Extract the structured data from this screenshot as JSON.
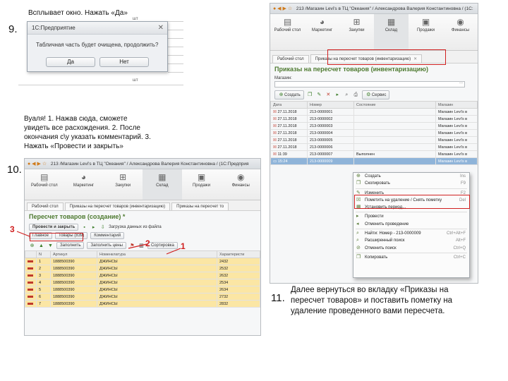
{
  "step9": {
    "number": "9.",
    "caption": "Всплывает окно. Нажать «Да»",
    "dialog": {
      "title": "1С:Предприятие",
      "message": "Табличная часть будет очищена, продолжить?",
      "yes": "Да",
      "no": "Нет"
    },
    "bg_unit_top": "шт",
    "bg_unit_bottom": "шт"
  },
  "step10": {
    "number": "10.",
    "caption_lines": [
      "Вуаля! 1. Нажав сюда, сможете",
      "увидеть все расхождения. 2. После",
      "окончания с\\у указать комментарий. 3.",
      "Нажать «Провести и закрыть»"
    ],
    "window": {
      "title": "213 /Магазин Levi's в ТЦ \"Океания\" / Александрова Валерия Константиновна / (1С:Предприя",
      "sections": [
        "Рабочий стол",
        "Маркетинг",
        "Закупки",
        "Склад",
        "Продажи",
        "Финансы"
      ],
      "tabs": [
        "Рабочий стол",
        "Приказы на пересчет товаров (инвентаризацию)",
        "Приказы на пересчет то"
      ],
      "form_title": "Пересчет товаров (создание) *",
      "post_close": "Провести и закрыть",
      "load_file": "Загрузка данных из файла",
      "subtabs": [
        "Главное",
        "Товары (839)",
        "Комментарий"
      ],
      "fill_btn": "Заполнить",
      "fill_prices": "Заполнить цены",
      "sort": "Сортировка",
      "columns": [
        "N",
        "Артикул",
        "Номенклатура",
        "Характеристи"
      ],
      "rows": [
        {
          "n": "1",
          "art": "1888500390",
          "nom": "ДЖИНСЫ",
          "char": "2432"
        },
        {
          "n": "2",
          "art": "1888500390",
          "nom": "ДЖИНСЫ",
          "char": "2532"
        },
        {
          "n": "3",
          "art": "1888500390",
          "nom": "ДЖИНСЫ",
          "char": "2632"
        },
        {
          "n": "4",
          "art": "1888500390",
          "nom": "ДЖИНСЫ",
          "char": "2534"
        },
        {
          "n": "5",
          "art": "1888500390",
          "nom": "ДЖИНСЫ",
          "char": "2634"
        },
        {
          "n": "6",
          "art": "1888500390",
          "nom": "ДЖИНСЫ",
          "char": "2732"
        },
        {
          "n": "7",
          "art": "1888500390",
          "nom": "ДЖИНСЫ",
          "char": "2832"
        }
      ]
    },
    "markers": [
      "1",
      "2",
      "3"
    ]
  },
  "step11": {
    "number": "11.",
    "caption_lines": [
      "Далее вернуться во вкладку «Приказы на",
      "пересчет товаров» и поставить пометку на",
      "удаление проведенного вами пересчета."
    ],
    "window": {
      "title": "213 /Магазин Levi's в ТЦ \"Океания\" / Александрова Валерия Константиновна / (1С:",
      "sections": [
        "Рабочий стол",
        "Маркетинг",
        "Закупки",
        "Склад",
        "Продажи",
        "Финансы"
      ],
      "tabs": [
        "Рабочий стол",
        "Приказы на пересчет товаров (инвентаризацию)"
      ],
      "form_title": "Приказы на пересчет товаров (инвентаризацию)",
      "store_label": "Магазин:",
      "create": "Создать",
      "service": "Сервис",
      "columns": [
        "Дата",
        "Номер",
        "Состояние",
        "Магазин"
      ],
      "rows": [
        {
          "date": "27.11.2018",
          "num": "213-0000001",
          "state": "",
          "store": "Магазин Levi's в"
        },
        {
          "date": "27.11.2018",
          "num": "213-0000002",
          "state": "",
          "store": "Магазин Levi's в"
        },
        {
          "date": "27.11.2018",
          "num": "213-0000003",
          "state": "",
          "store": "Магазин Levi's в"
        },
        {
          "date": "27.11.2018",
          "num": "213-0000004",
          "state": "",
          "store": "Магазин Levi's в"
        },
        {
          "date": "27.11.2018",
          "num": "213-0000005",
          "state": "",
          "store": "Магазин Levi's в"
        },
        {
          "date": "27.11.2018",
          "num": "213-0000006",
          "state": "",
          "store": "Магазин Levi's в"
        },
        {
          "date": "11:39",
          "num": "213-0000007",
          "state": "Выполнен",
          "store": "Магазин Levi's в"
        },
        {
          "date": "15:24",
          "num": "213-0000009",
          "state": "",
          "store": "Магазин Levi's в"
        }
      ],
      "context_menu": [
        {
          "label": "Создать",
          "shortcut": "Ins"
        },
        {
          "label": "Скопировать",
          "shortcut": "F9"
        },
        {
          "label": "Изменить",
          "shortcut": "F2"
        },
        {
          "label": "Пометить на удаление / Снять пометку",
          "shortcut": "Del"
        },
        {
          "label": "Установить период...",
          "shortcut": ""
        },
        {
          "label": "Провести",
          "shortcut": ""
        },
        {
          "label": "Отменить проведение",
          "shortcut": ""
        },
        {
          "label": "Найти: Номер - 213-0000009",
          "shortcut": "Ctrl+Alt+F"
        },
        {
          "label": "Расширенный поиск",
          "shortcut": "Alt+F"
        },
        {
          "label": "Отменить поиск",
          "shortcut": "Ctrl+Q"
        },
        {
          "label": "Копировать",
          "shortcut": "Ctrl+C"
        }
      ]
    }
  }
}
